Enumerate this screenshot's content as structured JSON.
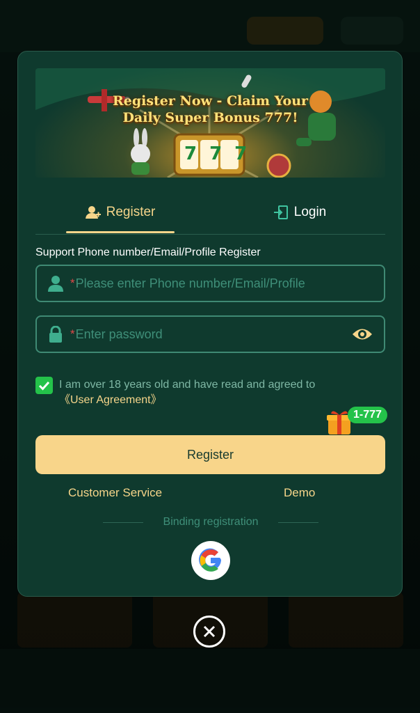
{
  "banner": {
    "line1": "Register Now - Claim Your",
    "line2": "Daily Super Bonus 777!",
    "reel": "777"
  },
  "tabs": [
    {
      "label": "Register",
      "icon": "user-plus-icon",
      "active": true
    },
    {
      "label": "Login",
      "icon": "login-door-icon",
      "active": false
    }
  ],
  "form": {
    "support_label": "Support Phone number/Email/Profile Register",
    "account_placeholder": "Please enter Phone number/Email/Profile",
    "password_placeholder": "Enter password",
    "required_mark": "*"
  },
  "agreement": {
    "checked": true,
    "text": "I am over 18 years old and have read and agreed to",
    "link": "《User Agreement》"
  },
  "bonus_badge": "1-777",
  "register_button": "Register",
  "links": {
    "customer_service": "Customer Service",
    "demo": "Demo"
  },
  "binding_label": "Binding registration",
  "colors": {
    "modal_bg": "#0f3a2e",
    "accent_gold": "#f6d58a",
    "button_gold": "#f8d58a",
    "field_border": "#3f8a74",
    "check_green": "#24c24a",
    "required_red": "#e04848"
  }
}
